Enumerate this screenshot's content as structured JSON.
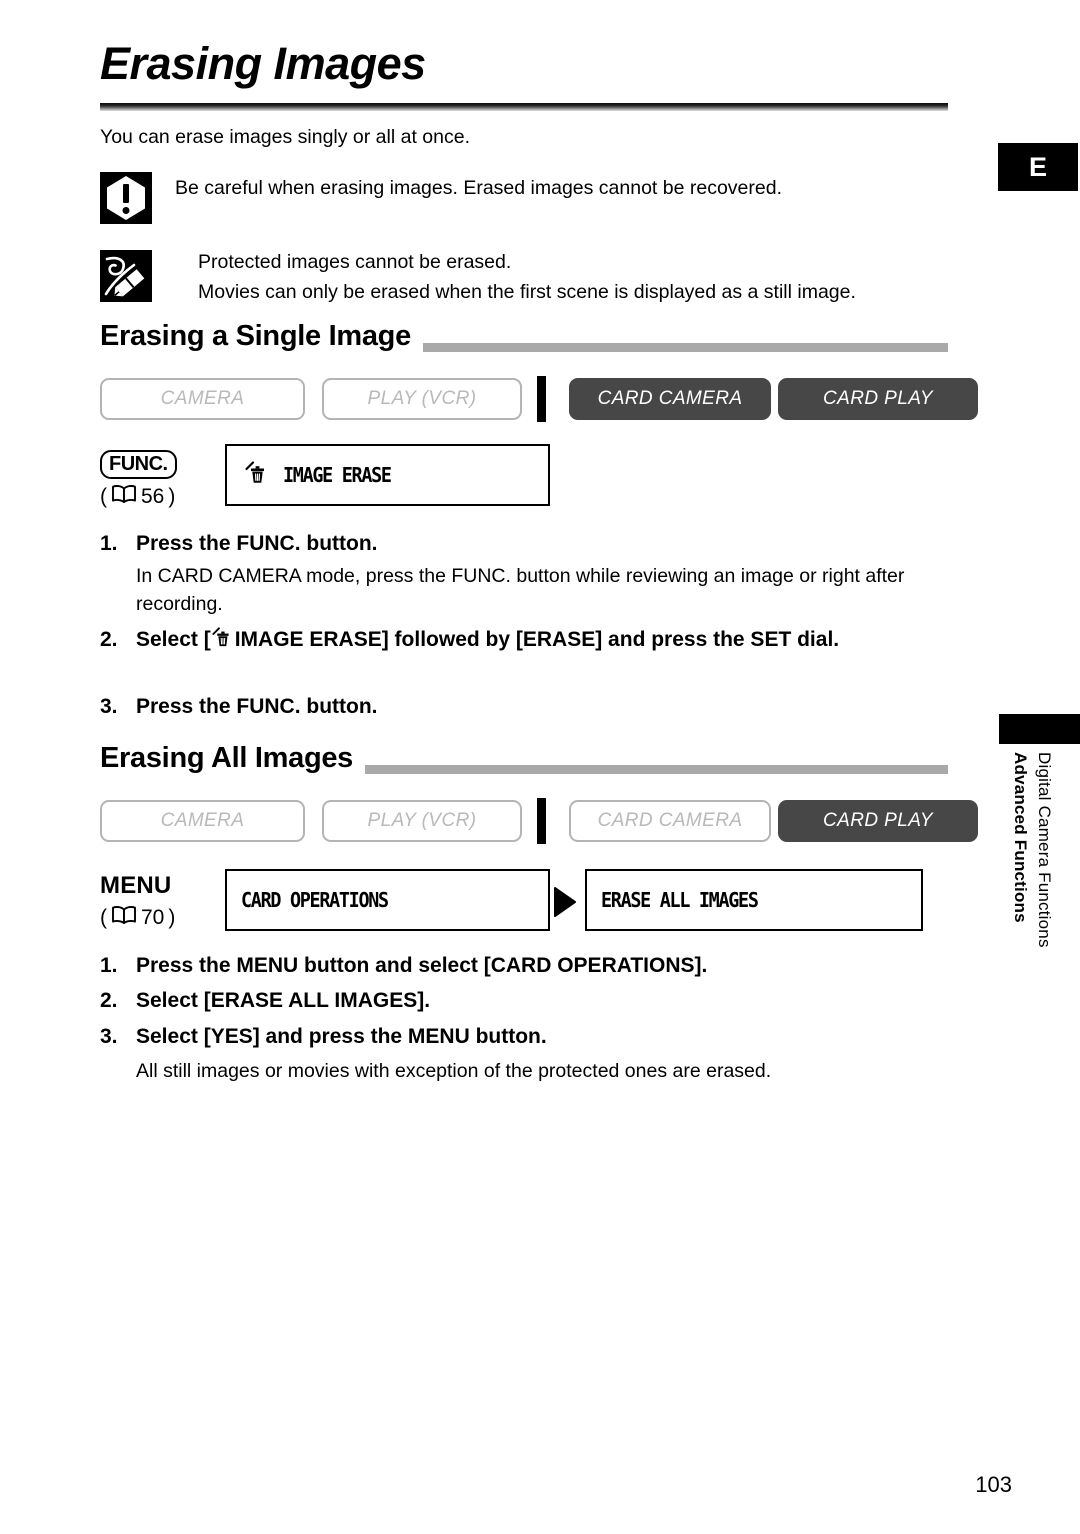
{
  "page": {
    "title": "Erasing Images",
    "intro": "You can erase images singly or all at once.",
    "folio": "103",
    "language_tab": "E"
  },
  "notes": [
    {
      "icon": "warning-icon",
      "lines": [
        "Be careful when erasing images. Erased images cannot be recovered."
      ]
    },
    {
      "icon": "memo-icon",
      "lines": [
        "Protected images cannot be erased.",
        "Movies can only be erased when the first scene is displayed as a still image."
      ]
    }
  ],
  "sections": [
    {
      "heading": "Erasing a Single Image",
      "modes": [
        {
          "label": "CAMERA",
          "active": false
        },
        {
          "label": "PLAY (VCR)",
          "active": false
        },
        {
          "label": "CARD CAMERA",
          "active": true
        },
        {
          "label": "CARD PLAY",
          "active": true
        }
      ],
      "control": {
        "button_label": "FUNC.",
        "page_reference": "56",
        "boxes": [
          {
            "icon": "trash-erase-icon",
            "label": "IMAGE ERASE"
          }
        ]
      },
      "steps": [
        {
          "num": "1.",
          "text": "Press the FUNC. button.",
          "sub": "In CARD CAMERA mode, press the FUNC. button while reviewing an image or right after recording."
        },
        {
          "num": "2.",
          "text_before": "Select [",
          "text_after": "IMAGE ERASE] followed by [ERASE] and press the SET dial.",
          "icon": "trash-erase-icon"
        },
        {
          "num": "3.",
          "text": "Press the FUNC. button."
        }
      ]
    },
    {
      "heading": "Erasing All Images",
      "modes": [
        {
          "label": "CAMERA",
          "active": false
        },
        {
          "label": "PLAY (VCR)",
          "active": false
        },
        {
          "label": "CARD CAMERA",
          "active": false
        },
        {
          "label": "CARD PLAY",
          "active": true
        }
      ],
      "control": {
        "button_label": "MENU",
        "page_reference": "70",
        "boxes": [
          {
            "label": "CARD OPERATIONS"
          },
          {
            "label": "ERASE ALL IMAGES"
          }
        ]
      },
      "steps": [
        {
          "num": "1.",
          "text": "Press the MENU button and select [CARD OPERATIONS]."
        },
        {
          "num": "2.",
          "text": "Select [ERASE ALL IMAGES]."
        },
        {
          "num": "3.",
          "text": "Select [YES] and press the MENU button.",
          "sub": "All still images or movies with exception of the protected ones are erased."
        }
      ]
    }
  ],
  "sidebar": {
    "title": "Advanced Functions",
    "subtitle": "Digital Camera Functions"
  },
  "colors": {
    "active_badge": "#474747",
    "inactive_badge_border": "#b4b4b4",
    "inactive_badge_text": "#b9b9b9",
    "section_rule": "#a9a9a9"
  }
}
